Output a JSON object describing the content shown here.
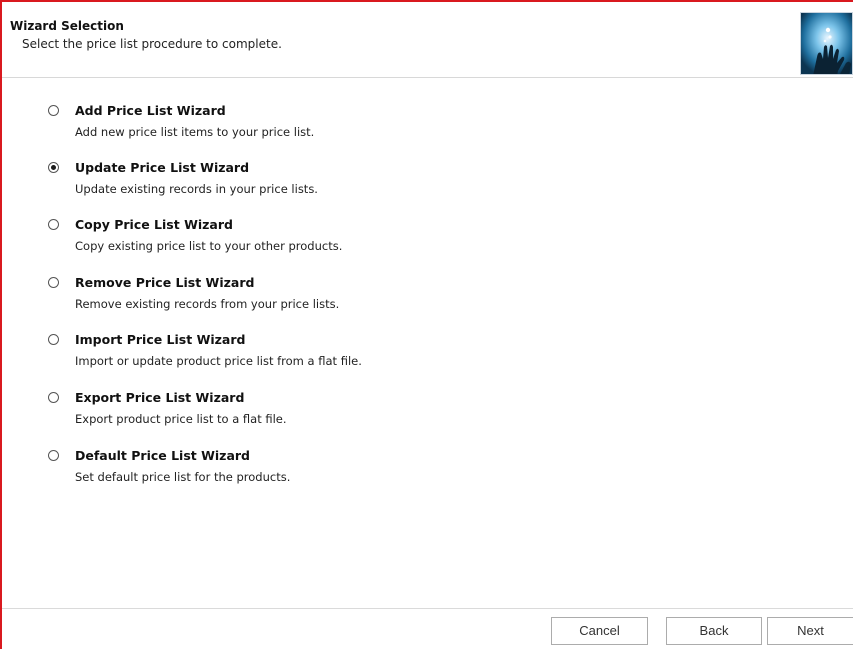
{
  "header": {
    "title": "Wizard Selection",
    "subtitle": "Select the price list procedure to complete.",
    "image": "wizard-hand-icon"
  },
  "options": [
    {
      "label": "Add Price List Wizard",
      "description": "Add new price list items to your price list.",
      "selected": false
    },
    {
      "label": "Update Price List Wizard",
      "description": "Update existing records in your price lists.",
      "selected": true
    },
    {
      "label": "Copy Price List Wizard",
      "description": "Copy existing price list to your other products.",
      "selected": false
    },
    {
      "label": "Remove Price List Wizard",
      "description": "Remove existing records from your price lists.",
      "selected": false
    },
    {
      "label": "Import Price List Wizard",
      "description": "Import or update product price list from a flat file.",
      "selected": false
    },
    {
      "label": "Export Price List Wizard",
      "description": "Export product price list to a flat file.",
      "selected": false
    },
    {
      "label": "Default Price List Wizard",
      "description": "Set default price list for the products.",
      "selected": false
    }
  ],
  "buttons": {
    "cancel_label": "Cancel",
    "back_label": "Back",
    "next_label": "Next"
  },
  "colors": {
    "frame_border": "#d9191f",
    "background": "#ffffff"
  }
}
